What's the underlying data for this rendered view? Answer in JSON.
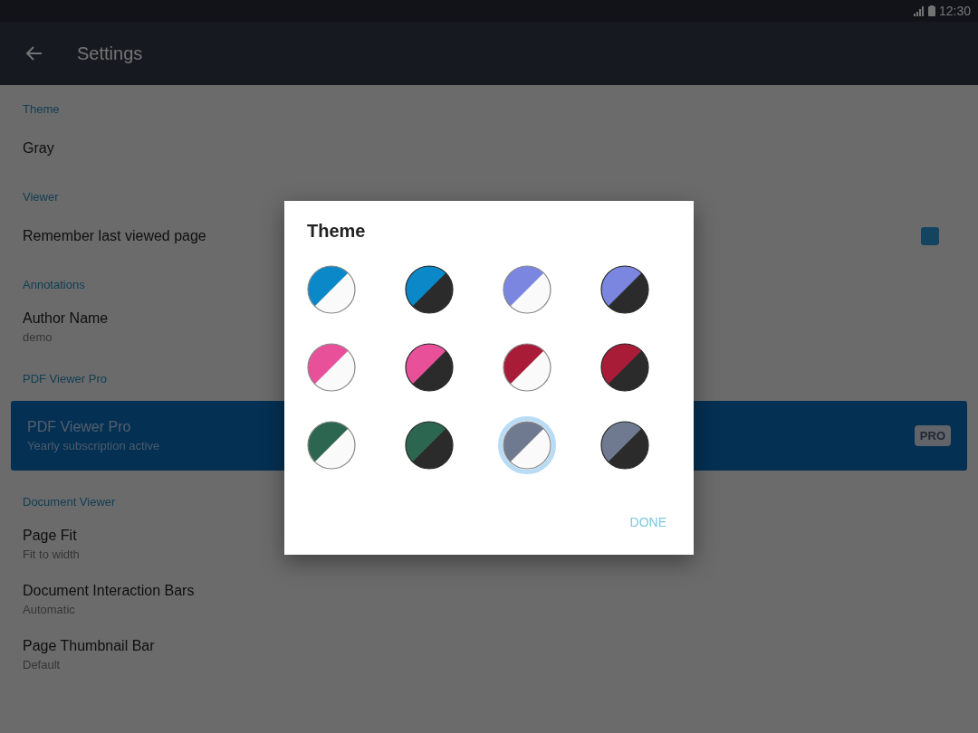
{
  "status_bar": {
    "time": "12:30"
  },
  "toolbar": {
    "title": "Settings"
  },
  "settings": [
    {
      "kind": "header",
      "title": "Theme"
    },
    {
      "kind": "item",
      "title": "Gray"
    },
    {
      "kind": "header",
      "title": "Viewer"
    },
    {
      "kind": "checkbox",
      "title": "Remember last viewed page",
      "checked": true
    },
    {
      "kind": "header",
      "title": "Annotations"
    },
    {
      "kind": "item",
      "title": "Author Name",
      "subtitle": "demo"
    },
    {
      "kind": "header",
      "title": "PDF Viewer Pro"
    },
    {
      "kind": "pro",
      "title": "PDF Viewer Pro",
      "subtitle": "Yearly subscription active",
      "badge": "PRO"
    },
    {
      "kind": "header",
      "title": "Document Viewer"
    },
    {
      "kind": "item",
      "title": "Page Fit",
      "subtitle": "Fit to width"
    },
    {
      "kind": "item",
      "title": "Document Interaction Bars",
      "subtitle": "Automatic"
    },
    {
      "kind": "item",
      "title": "Page Thumbnail Bar",
      "subtitle": "Default"
    }
  ],
  "dialog": {
    "title": "Theme",
    "button": "DONE",
    "swatches": [
      {
        "color": "#0a88c8",
        "dark": false,
        "selected": false
      },
      {
        "color": "#0a88c8",
        "dark": true,
        "selected": false
      },
      {
        "color": "#7a86e0",
        "dark": false,
        "selected": false
      },
      {
        "color": "#7a86e0",
        "dark": true,
        "selected": false
      },
      {
        "color": "#e8519a",
        "dark": false,
        "selected": false
      },
      {
        "color": "#e8519a",
        "dark": true,
        "selected": false
      },
      {
        "color": "#a81c38",
        "dark": false,
        "selected": false
      },
      {
        "color": "#a81c38",
        "dark": true,
        "selected": false
      },
      {
        "color": "#2d6650",
        "dark": false,
        "selected": false
      },
      {
        "color": "#2d6650",
        "dark": true,
        "selected": false
      },
      {
        "color": "#6f7a90",
        "dark": false,
        "selected": true
      },
      {
        "color": "#6f7a90",
        "dark": true,
        "selected": false
      }
    ]
  }
}
